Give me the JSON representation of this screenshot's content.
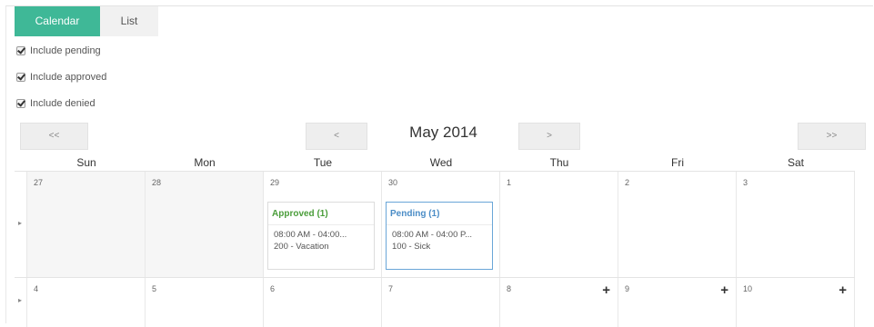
{
  "tabs": [
    {
      "label": "Calendar",
      "active": true
    },
    {
      "label": "List",
      "active": false
    }
  ],
  "filters": [
    {
      "label": "Include pending",
      "checked": true
    },
    {
      "label": "Include approved",
      "checked": true
    },
    {
      "label": "Include denied",
      "checked": true
    }
  ],
  "nav": {
    "prev_year": "<<",
    "prev_month": "<",
    "title": "May 2014",
    "next_month": ">",
    "next_year": ">>"
  },
  "weekdays": [
    "Sun",
    "Mon",
    "Tue",
    "Wed",
    "Thu",
    "Fri",
    "Sat"
  ],
  "week_toggle": "▸",
  "weeks": [
    {
      "days": [
        "27",
        "28",
        "29",
        "30",
        "1",
        "2",
        "3"
      ],
      "past": [
        true,
        true,
        false,
        false,
        false,
        false,
        false
      ],
      "add": [
        false,
        false,
        false,
        false,
        false,
        false,
        false
      ]
    },
    {
      "days": [
        "4",
        "5",
        "6",
        "7",
        "8",
        "9",
        "10"
      ],
      "past": [
        false,
        false,
        false,
        false,
        false,
        false,
        false
      ],
      "add": [
        false,
        false,
        false,
        false,
        true,
        true,
        true
      ]
    }
  ],
  "add_label": "+",
  "events": [
    {
      "status": "approved",
      "header": "Approved (1)",
      "time": "08:00 AM - 04:00...",
      "detail": "200 - Vacation"
    },
    {
      "status": "pending",
      "header": "Pending (1)",
      "time": "08:00 AM - 04:00 P...",
      "detail": "100 - Sick"
    }
  ],
  "colors": {
    "accent": "#3fb897",
    "approved": "#4a9d3a",
    "pending": "#4a8cc6"
  }
}
